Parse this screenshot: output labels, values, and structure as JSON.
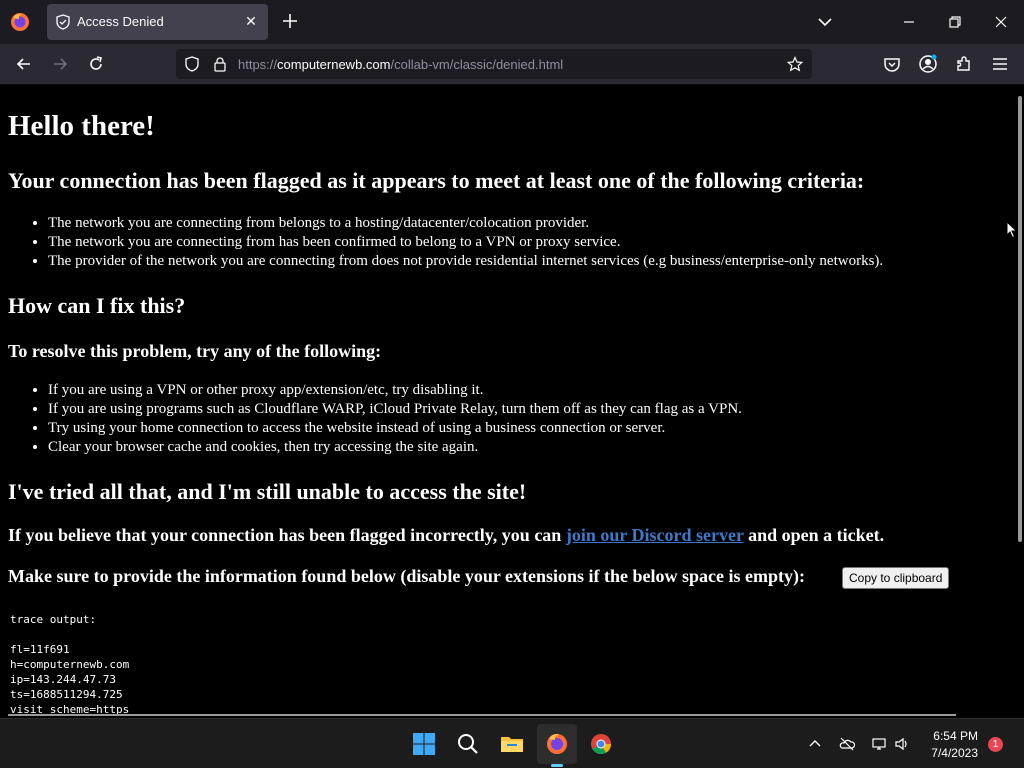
{
  "browser": {
    "tab": {
      "title": "Access Denied",
      "favicon": "shield-page-icon"
    },
    "url": {
      "scheme": "https://",
      "host": "computernewb.com",
      "path": "/collab-vm/classic/denied.html"
    }
  },
  "page": {
    "heading": "Hello there!",
    "criteria_heading": "Your connection has been flagged as it appears to meet at least one of the following criteria:",
    "criteria": [
      "The network you are connecting from belongs to a hosting/datacenter/colocation provider.",
      "The network you are connecting from has been confirmed to belong to a VPN or proxy service.",
      "The provider of the network you are connecting from does not provide residential internet services (e.g business/enterprise-only networks)."
    ],
    "fix_heading": "How can I fix this?",
    "resolve_heading": "To resolve this problem, try any of the following:",
    "fixes": [
      "If you are using a VPN or other proxy app/extension/etc, try disabling it.",
      "If you are using programs such as Cloudflare WARP, iCloud Private Relay, turn them off as they can flag as a VPN.",
      "Try using your home connection to access the website instead of using a business connection or server.",
      "Clear your browser cache and cookies, then try accessing the site again."
    ],
    "still_heading": "I've tried all that, and I'm still unable to access the site!",
    "discord_prefix": "If you believe that your connection has been flagged incorrectly, you can ",
    "discord_link": "join our Discord server",
    "discord_suffix": " and open a ticket.",
    "info_text": "Make sure to provide the information found below (disable your extensions if the below space is empty):",
    "copy_button": "Copy to clipboard",
    "trace": "trace output:\n\nfl=11f691\nh=computernewb.com\nip=143.244.47.73\nts=1688511294.725\nvisit_scheme=https"
  },
  "taskbar": {
    "time": "6:54 PM",
    "date": "7/4/2023",
    "notification_count": "1",
    "pinned": [
      "windows-start-icon",
      "search-icon",
      "file-explorer-icon",
      "firefox-icon",
      "chrome-icon"
    ]
  }
}
